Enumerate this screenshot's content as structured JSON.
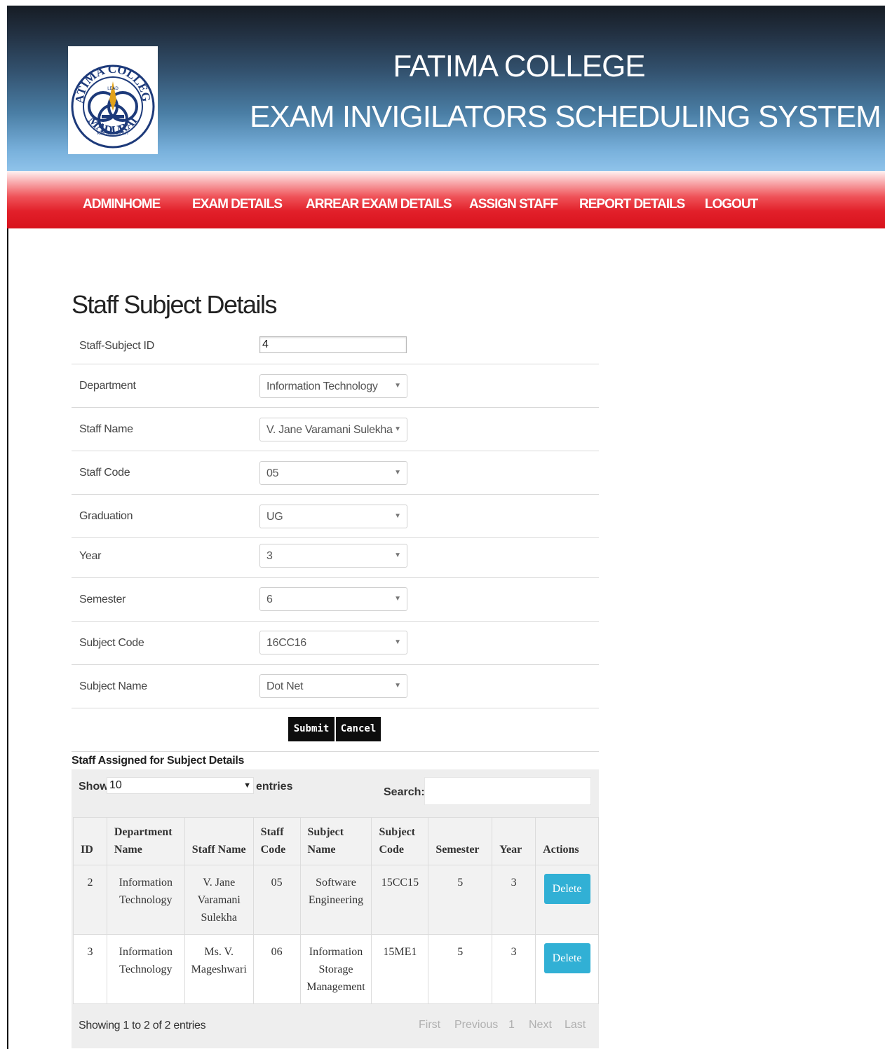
{
  "header": {
    "college_name": "FATIMA COLLEGE",
    "system_name": "EXAM INVIGILATORS SCHEDULING SYSTEM",
    "logo_text_top": "FATIMA COLLEGE",
    "logo_text_bottom": "MADURAI",
    "logo_center_text": "LEAD",
    "logo_ribbon": "KINDLE · LIGHT"
  },
  "nav": {
    "items": [
      "ADMINHOME",
      "EXAM DETAILS",
      "ARREAR EXAM DETAILS",
      "ASSIGN STAFF",
      "REPORT DETAILS",
      "LOGOUT"
    ]
  },
  "form": {
    "title": "Staff Subject Details",
    "fields": [
      {
        "label": "Staff-Subject ID",
        "value": "4"
      },
      {
        "label": "Department",
        "value": "Information Technology"
      },
      {
        "label": "Staff Name",
        "value": "V. Jane Varamani Sulekha"
      },
      {
        "label": "Staff Code",
        "value": "05"
      },
      {
        "label": "Graduation",
        "value": "UG"
      },
      {
        "label": "Year",
        "value": "3"
      },
      {
        "label": "Semester",
        "value": "6"
      },
      {
        "label": "Subject Code",
        "value": "16CC16"
      },
      {
        "label": "Subject Name",
        "value": "Dot Net"
      }
    ],
    "submit_label": "Submit",
    "cancel_label": "Cancel"
  },
  "table_section": {
    "title": "Staff Assigned for Subject Details",
    "show_label": "Show",
    "length_value": "10",
    "entries_label": "entries",
    "search_label": "Search:",
    "columns": [
      "ID",
      "Department Name",
      "Staff Name",
      "Staff Code",
      "Subject Name",
      "Subject Code",
      "Semester",
      "Year",
      "Actions"
    ],
    "rows": [
      {
        "id": "2",
        "department": "Information Technology",
        "staff": "V. Jane Varamani Sulekha",
        "code": "05",
        "subject": "Software Engineering",
        "subject_code": "15CC15",
        "semester": "5",
        "year": "3",
        "action": "Delete"
      },
      {
        "id": "3",
        "department": "Information Technology",
        "staff": "Ms. V. Mageshwari",
        "code": "06",
        "subject": "Information Storage Management",
        "subject_code": "15ME1",
        "semester": "5",
        "year": "3",
        "action": "Delete"
      }
    ],
    "info": "Showing 1 to 2 of 2 entries",
    "pagination": {
      "first": "First",
      "previous": "Previous",
      "page": "1",
      "next": "Next",
      "last": "Last"
    }
  },
  "colors": {
    "nav_red": "#e2202a",
    "header_blue": "#4a7ea5",
    "delete_button": "#31b0d5",
    "dark_button": "#0d0d0d"
  }
}
